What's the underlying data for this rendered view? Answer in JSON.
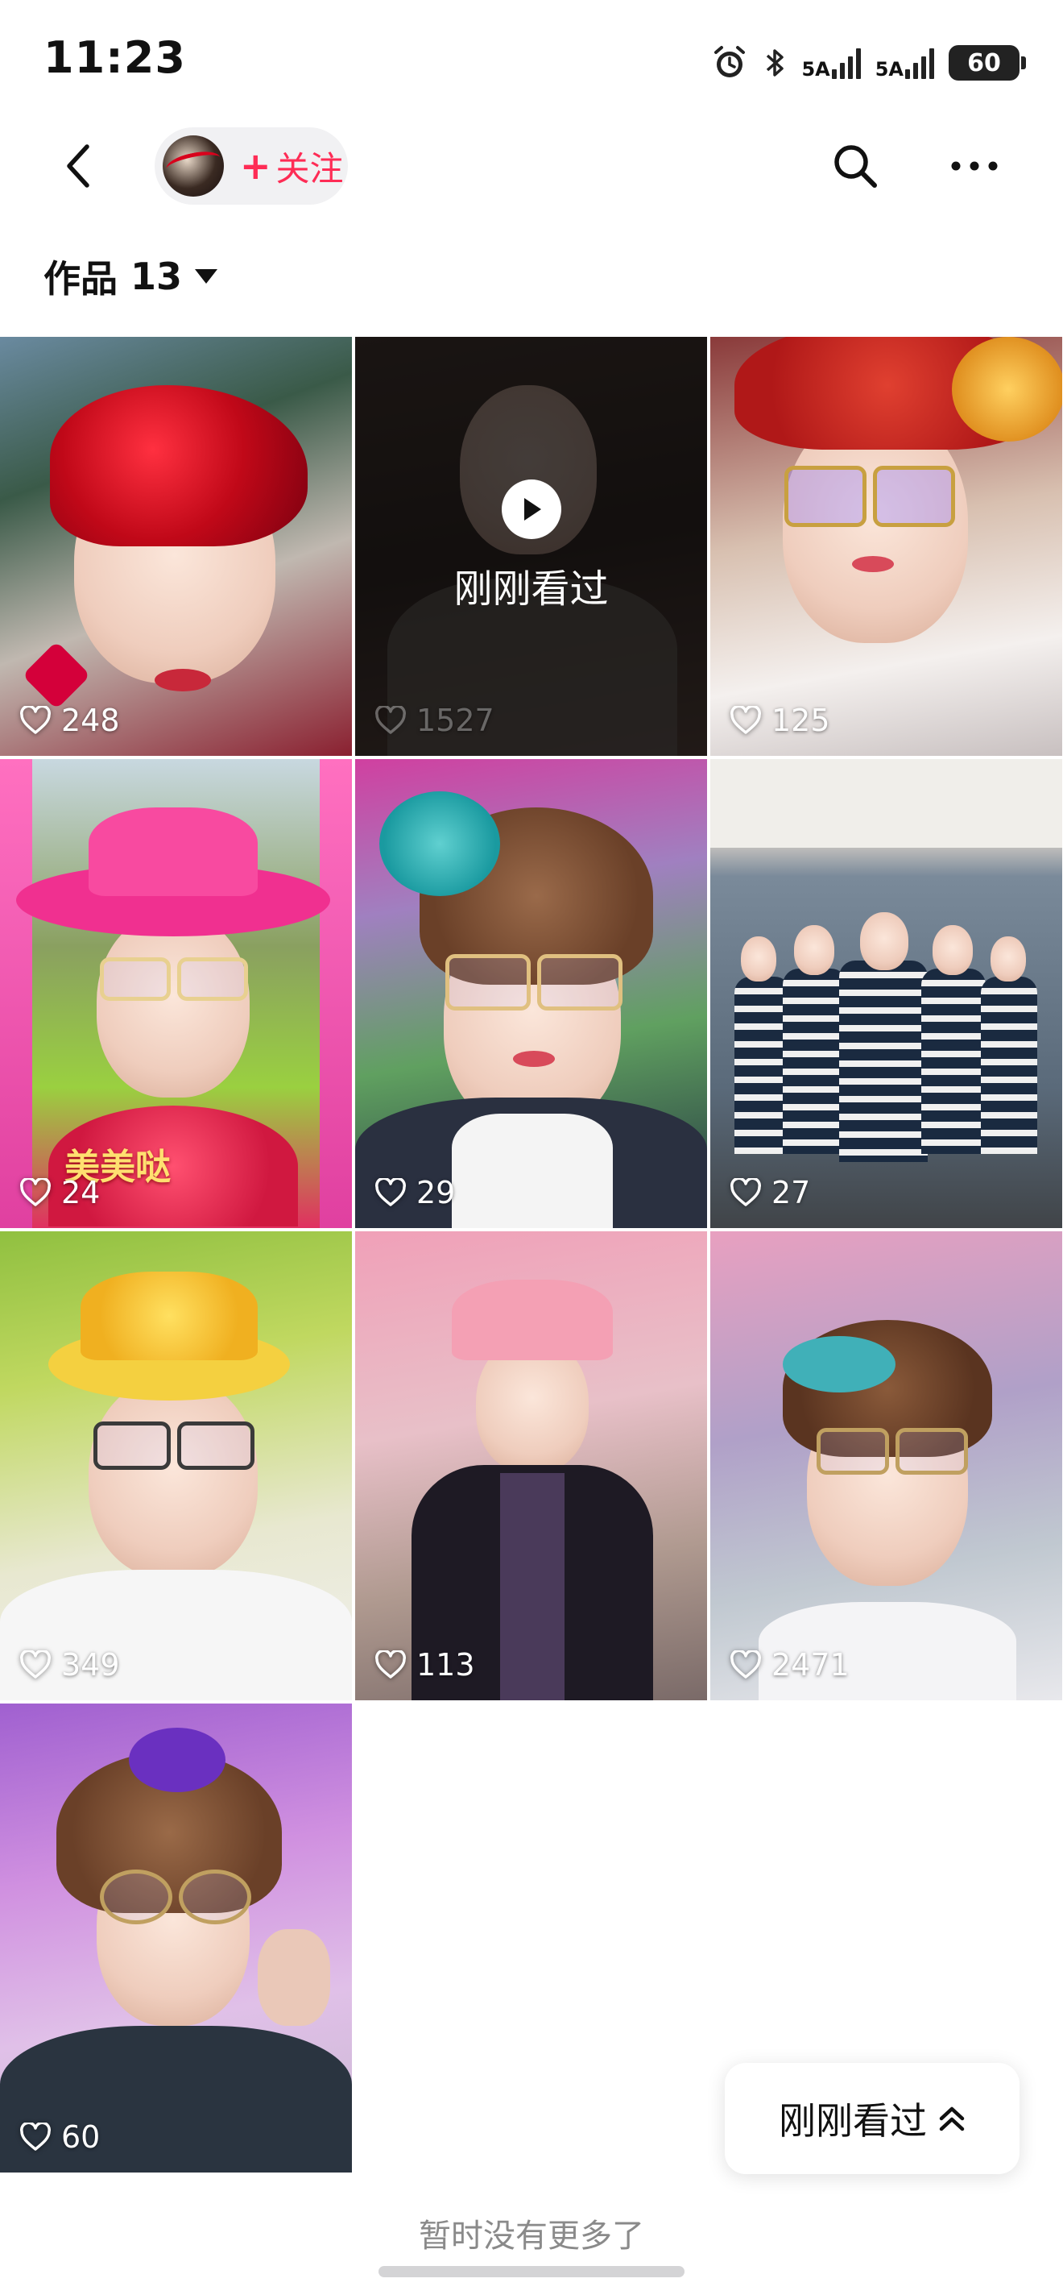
{
  "status_bar": {
    "time": "11:23",
    "network_1": "5A",
    "network_2": "5A",
    "battery": "60"
  },
  "nav": {
    "follow_label": "关注",
    "follow_plus": "+"
  },
  "works": {
    "label": "作品",
    "count": "13"
  },
  "videos": [
    {
      "likes": "248",
      "watched": false
    },
    {
      "likes": "1527",
      "watched": true,
      "watched_label": "刚刚看过"
    },
    {
      "likes": "125",
      "watched": false
    },
    {
      "likes": "24",
      "watched": false,
      "sticker_text": "美美哒"
    },
    {
      "likes": "29",
      "watched": false
    },
    {
      "likes": "27",
      "watched": false
    },
    {
      "likes": "349",
      "watched": false
    },
    {
      "likes": "113",
      "watched": false
    },
    {
      "likes": "2471",
      "watched": false
    },
    {
      "likes": "60",
      "watched": false
    }
  ],
  "recent_button": {
    "label": "刚刚看过"
  },
  "footer": {
    "no_more": "暂时没有更多了"
  },
  "colors": {
    "accent": "#fe2c55",
    "text": "#111111",
    "muted": "#8a8a8a"
  }
}
